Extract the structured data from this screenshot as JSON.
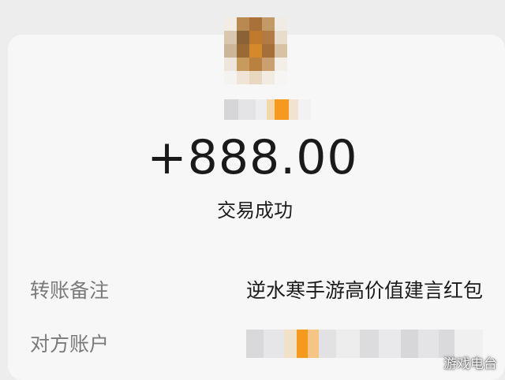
{
  "transaction": {
    "amount": "+888.00",
    "status": "交易成功"
  },
  "details": {
    "remark_label": "转账备注",
    "remark_value": "逆水寒手游高价值建言红包",
    "counterparty_label": "对方账户"
  },
  "watermark": "游戏电台",
  "colors": {
    "background": "#ededee",
    "card": "#f7f7f8",
    "accent_orange": "#f59a1e"
  }
}
